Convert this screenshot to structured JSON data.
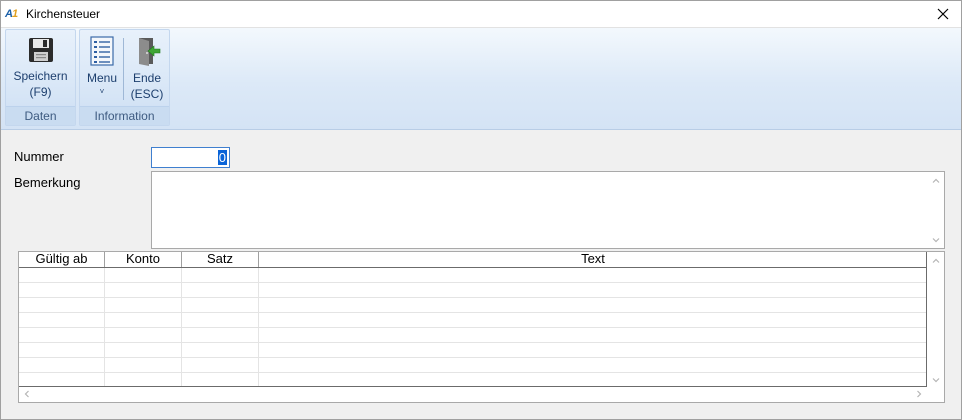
{
  "window": {
    "title": "Kirchensteuer",
    "logo_main": "A",
    "logo_accent": "1"
  },
  "ribbon": {
    "groups": [
      {
        "label": "Daten",
        "buttons": [
          {
            "label_line1": "Speichern",
            "label_line2": "(F9)",
            "icon": "save-icon"
          }
        ]
      },
      {
        "label": "Information",
        "buttons": [
          {
            "label_line1": "Menu",
            "dropdown": "˅",
            "icon": "menu-list-icon"
          },
          {
            "label_line1": "Ende",
            "label_line2": "(ESC)",
            "icon": "exit-door-icon"
          }
        ]
      }
    ]
  },
  "form": {
    "nummer_label": "Nummer",
    "nummer_value": "0",
    "bemerkung_label": "Bemerkung",
    "bemerkung_value": ""
  },
  "grid": {
    "columns": [
      "Gültig ab",
      "Konto",
      "Satz",
      "Text"
    ],
    "rows": [
      [
        "",
        "",
        "",
        ""
      ],
      [
        "",
        "",
        "",
        ""
      ],
      [
        "",
        "",
        "",
        ""
      ],
      [
        "",
        "",
        "",
        ""
      ],
      [
        "",
        "",
        "",
        ""
      ],
      [
        "",
        "",
        "",
        ""
      ],
      [
        "",
        "",
        "",
        ""
      ],
      [
        "",
        "",
        "",
        ""
      ]
    ]
  },
  "colors": {
    "accent": "#0a64d8",
    "ribbon_text": "#1d3f6e",
    "group_label": "#3d5a80"
  }
}
